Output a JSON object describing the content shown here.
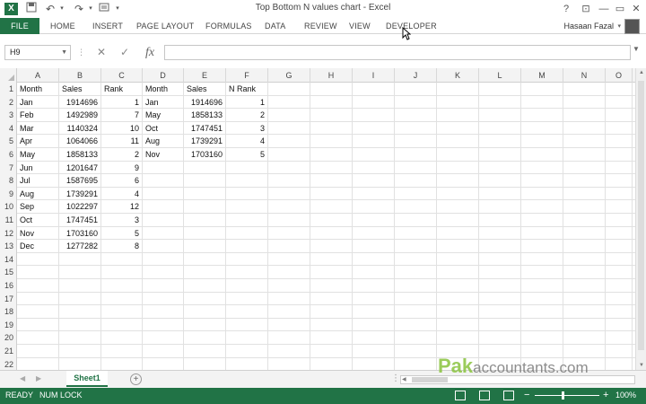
{
  "window": {
    "title": "Top Bottom N values chart - Excel",
    "user_name": "Hasaan Fazal",
    "app_icon_letter": "X",
    "min_glyph": "—",
    "restore_glyph": "▭",
    "close_glyph": "✕",
    "help_glyph": "?",
    "ribbon_opts_glyph": "⊡"
  },
  "ribbon": {
    "tabs": [
      "FILE",
      "HOME",
      "INSERT",
      "PAGE LAYOUT",
      "FORMULAS",
      "DATA",
      "REVIEW",
      "VIEW",
      "DEVELOPER"
    ]
  },
  "formula_bar": {
    "name_box": "H9",
    "formula": "",
    "fx_label": "fx"
  },
  "sheet": {
    "columns": [
      "A",
      "B",
      "C",
      "D",
      "E",
      "F",
      "G",
      "H",
      "I",
      "J",
      "K",
      "L",
      "M",
      "N",
      "O"
    ],
    "row_numbers": [
      "1",
      "2",
      "3",
      "4",
      "5",
      "6",
      "7",
      "8",
      "9",
      "10",
      "11",
      "12",
      "13",
      "14",
      "15",
      "16",
      "17",
      "18",
      "19",
      "20",
      "21",
      "22"
    ],
    "rows": [
      [
        "Month",
        "Sales",
        "Rank",
        "Month",
        "Sales",
        "N Rank"
      ],
      [
        "Jan",
        "1914696",
        "1",
        "Jan",
        "1914696",
        "1"
      ],
      [
        "Feb",
        "1492989",
        "7",
        "May",
        "1858133",
        "2"
      ],
      [
        "Mar",
        "1140324",
        "10",
        "Oct",
        "1747451",
        "3"
      ],
      [
        "Apr",
        "1064066",
        "11",
        "Aug",
        "1739291",
        "4"
      ],
      [
        "May",
        "1858133",
        "2",
        "Nov",
        "1703160",
        "5"
      ],
      [
        "Jun",
        "1201647",
        "9",
        "",
        "",
        ""
      ],
      [
        "Jul",
        "1587695",
        "6",
        "",
        "",
        ""
      ],
      [
        "Aug",
        "1739291",
        "4",
        "",
        "",
        ""
      ],
      [
        "Sep",
        "1022297",
        "12",
        "",
        "",
        ""
      ],
      [
        "Oct",
        "1747451",
        "3",
        "",
        "",
        ""
      ],
      [
        "Nov",
        "1703160",
        "5",
        "",
        "",
        ""
      ],
      [
        "Dec",
        "1277282",
        "8",
        "",
        "",
        ""
      ]
    ],
    "tab_name": "Sheet1",
    "add_sheet_glyph": "+"
  },
  "status": {
    "ready": "READY",
    "num_lock": "NUM LOCK",
    "zoom": "100%",
    "zoom_minus": "−",
    "zoom_plus": "+"
  },
  "watermark": {
    "brand": "Pak",
    "rest": "accountants.com"
  }
}
